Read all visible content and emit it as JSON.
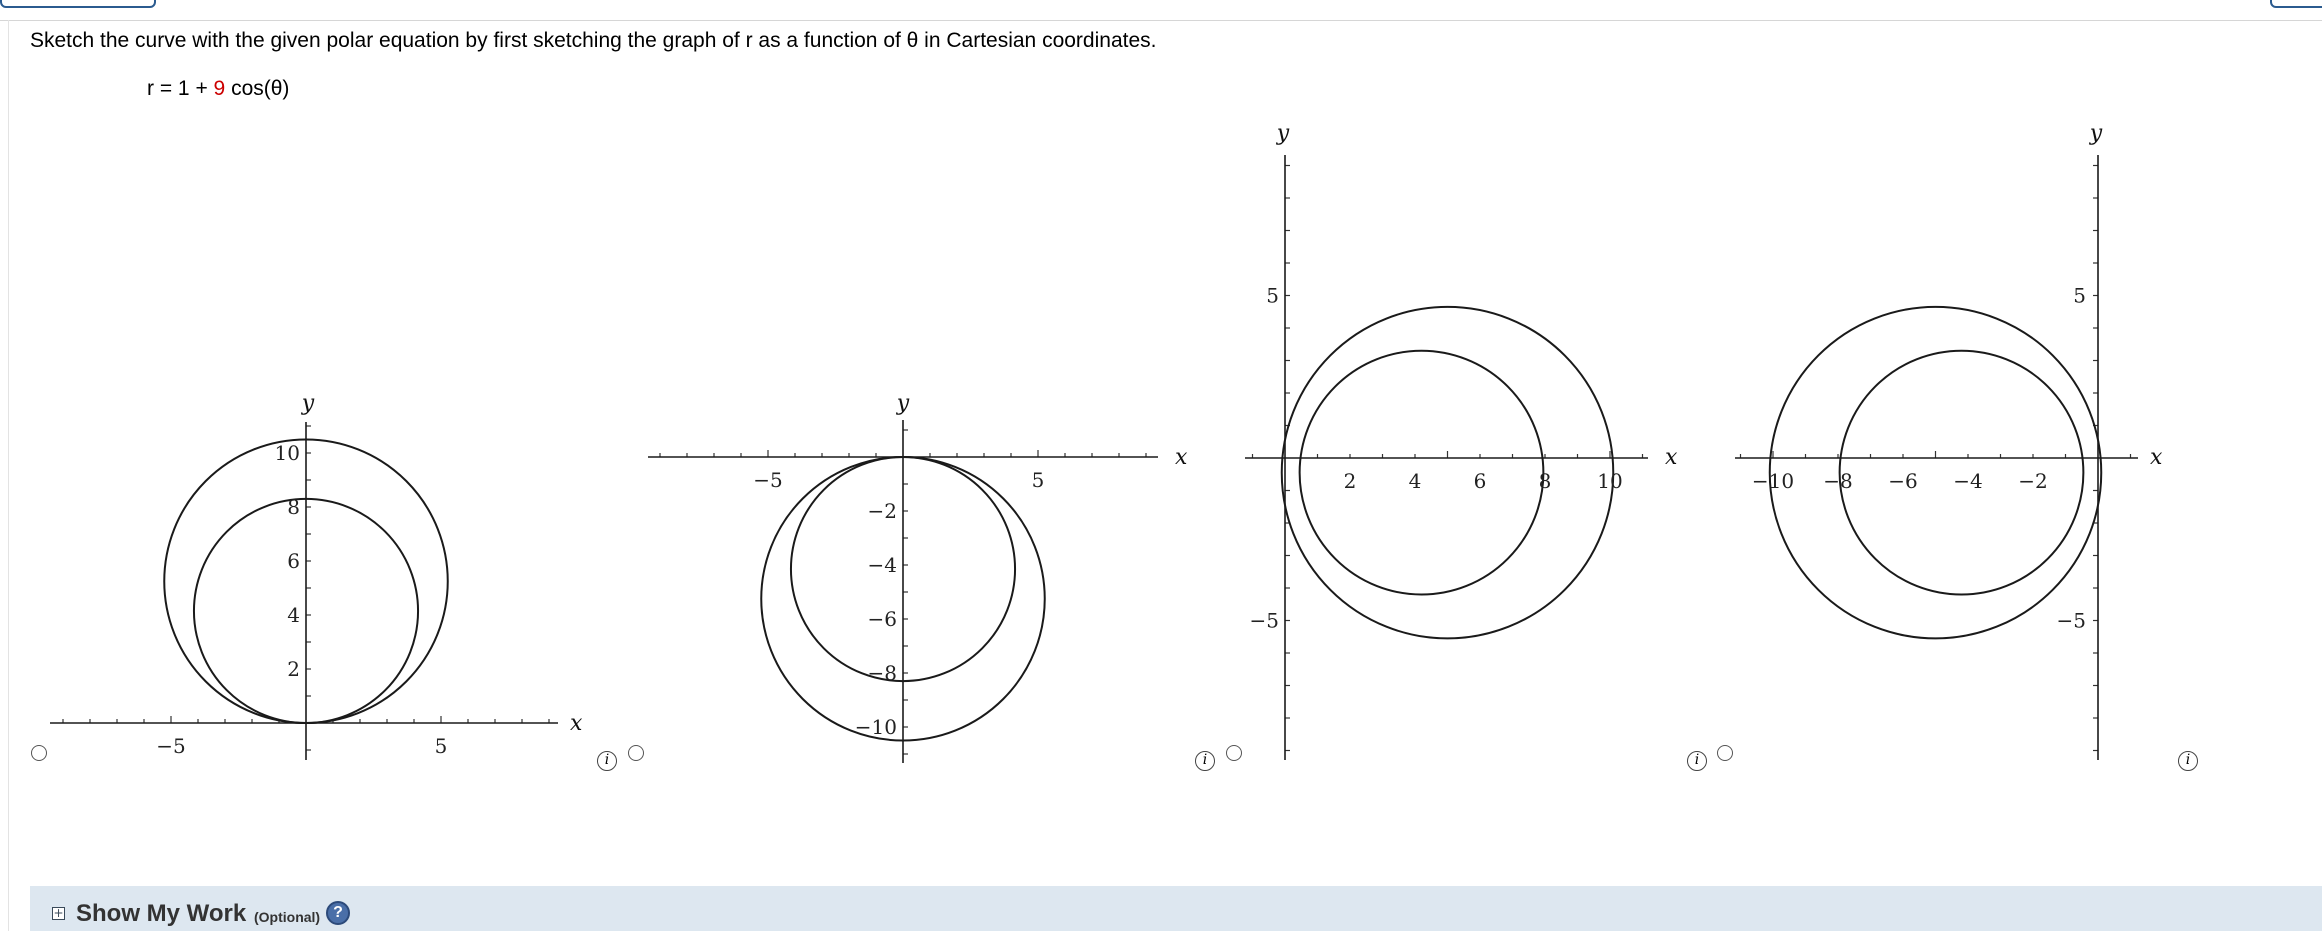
{
  "question": {
    "prompt": "Sketch the curve with the given polar equation by first sketching the graph of r as a function of θ in Cartesian coordinates.",
    "equation": {
      "lhs": "r = 1 + ",
      "coefficient": "9",
      "rhs": " cos(θ)"
    }
  },
  "choices": [
    {
      "axes": {
        "xlabel": "x",
        "ylabel": "y",
        "xticks": [
          {
            "v": -5,
            "t": "−5"
          },
          {
            "v": 5,
            "t": "5"
          }
        ],
        "yticks": [
          {
            "v": 2,
            "t": "2"
          },
          {
            "v": 4,
            "t": "4"
          },
          {
            "v": 6,
            "t": "6"
          },
          {
            "v": 8,
            "t": "8"
          },
          {
            "v": 10,
            "t": "10"
          }
        ]
      }
    },
    {
      "axes": {
        "xlabel": "x",
        "ylabel": "y",
        "xticks": [
          {
            "v": -5,
            "t": "−5"
          },
          {
            "v": 5,
            "t": "5"
          }
        ],
        "yticks": [
          {
            "v": -2,
            "t": "−2"
          },
          {
            "v": -4,
            "t": "−4"
          },
          {
            "v": -6,
            "t": "−6"
          },
          {
            "v": -8,
            "t": "−8"
          },
          {
            "v": -10,
            "t": "−10"
          }
        ]
      }
    },
    {
      "axes": {
        "xlabel": "x",
        "ylabel": "y",
        "xticks": [
          {
            "v": 2,
            "t": "2"
          },
          {
            "v": 4,
            "t": "4"
          },
          {
            "v": 6,
            "t": "6"
          },
          {
            "v": 8,
            "t": "8"
          },
          {
            "v": 10,
            "t": "10"
          }
        ],
        "yticks": [
          {
            "v": 5,
            "t": "5"
          },
          {
            "v": -5,
            "t": "−5"
          }
        ]
      }
    },
    {
      "axes": {
        "xlabel": "x",
        "ylabel": "y",
        "xticks": [
          {
            "v": -10,
            "t": "−10"
          },
          {
            "v": -8,
            "t": "−8"
          },
          {
            "v": -6,
            "t": "−6"
          },
          {
            "v": -4,
            "t": "−4"
          },
          {
            "v": -2,
            "t": "−2"
          }
        ],
        "yticks": [
          {
            "v": 5,
            "t": "5"
          },
          {
            "v": -5,
            "t": "−5"
          }
        ]
      }
    }
  ],
  "info_glyph": "i",
  "show_my_work": {
    "label": "Show My Work",
    "optional": "(Optional)",
    "help": "?"
  }
}
